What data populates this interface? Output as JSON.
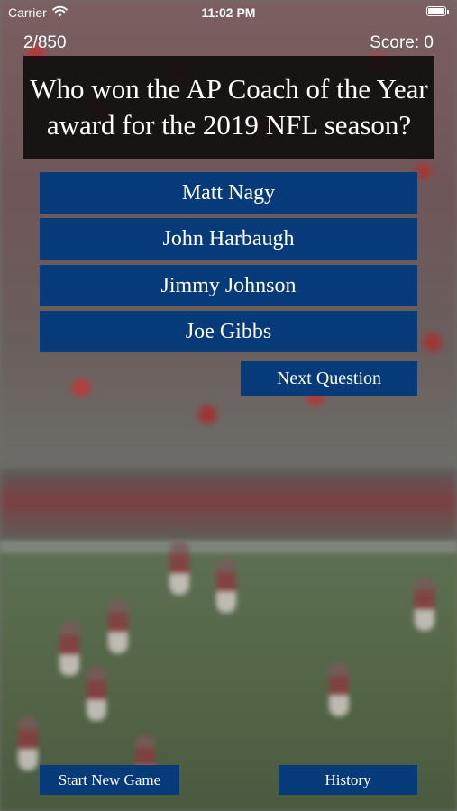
{
  "status_bar": {
    "carrier": "Carrier",
    "time": "11:02 PM",
    "wifi_icon": "wifi-icon",
    "battery_icon": "battery-icon"
  },
  "header": {
    "counter": "2/850",
    "score": "Score: 0"
  },
  "question": "Who won the AP Coach of the Year award for the 2019 NFL season?",
  "answers": [
    "Matt Nagy",
    "John Harbaugh",
    "Jimmy Johnson",
    "Joe Gibbs"
  ],
  "next_label": "Next Question",
  "footer": {
    "new_game_label": "Start New Game",
    "history_label": "History"
  },
  "colors": {
    "button_blue": "#073a78",
    "question_bg": "#0a0a0a"
  }
}
